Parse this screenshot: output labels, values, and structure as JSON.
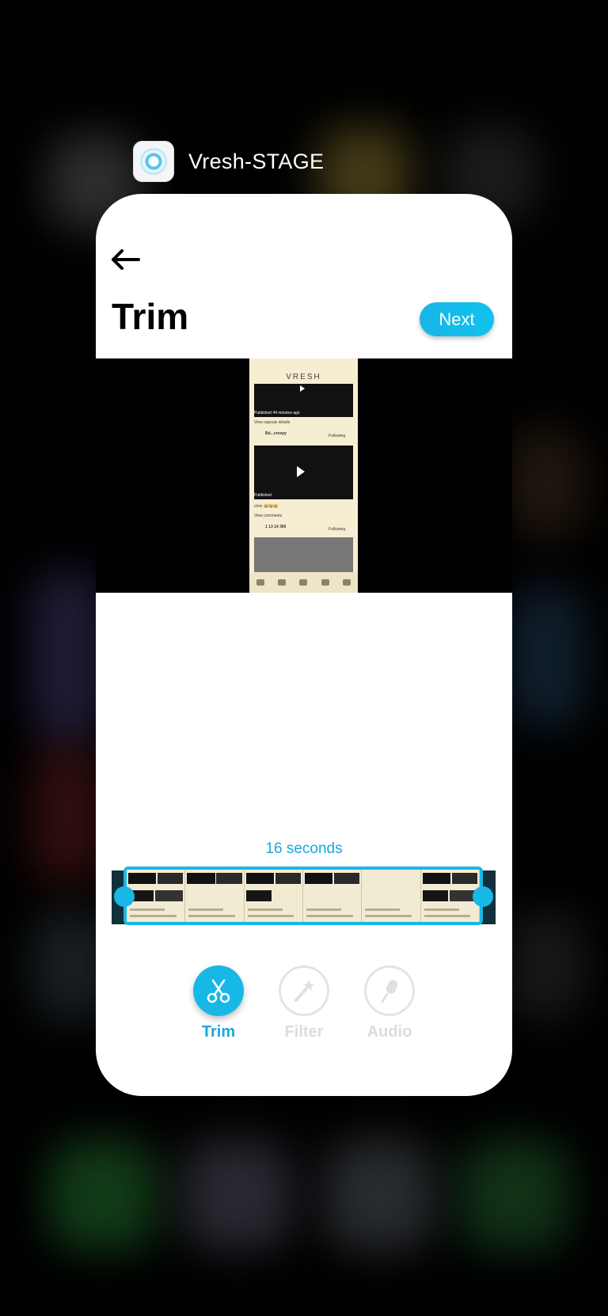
{
  "app": {
    "name": "Vresh-STAGE"
  },
  "screen": {
    "title": "Trim",
    "next_label": "Next"
  },
  "preview": {
    "logo": "VRESH",
    "status_1": "Published",
    "time_1": "44 minutes ago",
    "capsule_link": "View capsule details",
    "user_1": "Bd...creepy",
    "follow_1": "Following",
    "status_2": "Published",
    "caption": "chris 😂😂😂",
    "comments_link": "View comments",
    "user_2": "1 13 14 360",
    "follow_2": "Following"
  },
  "trim": {
    "duration": "16 seconds"
  },
  "tools": [
    {
      "label": "Trim",
      "icon": "scissors-icon",
      "active": true
    },
    {
      "label": "Filter",
      "icon": "magic-wand-icon",
      "active": false
    },
    {
      "label": "Audio",
      "icon": "microphone-icon",
      "active": false
    }
  ],
  "colors": {
    "accent": "#18b8e6",
    "inactive": "#dcdcdc"
  }
}
